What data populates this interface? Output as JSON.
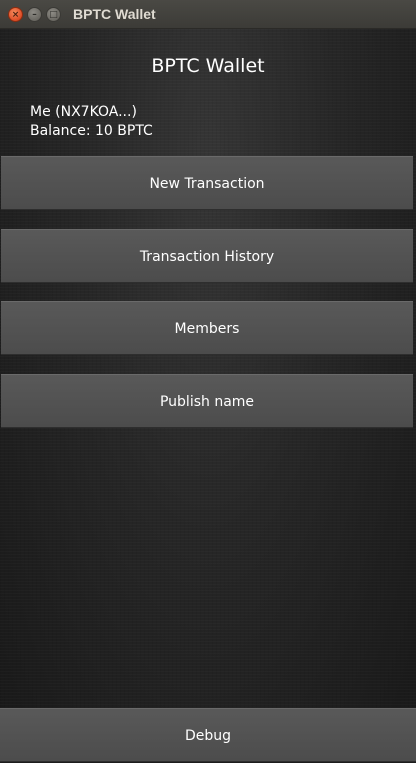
{
  "window": {
    "title": "BPTC Wallet",
    "close_glyph": "×",
    "minimize_glyph": "–",
    "maximize_glyph": "□"
  },
  "app": {
    "title": "BPTC Wallet",
    "account_name": "Me (NX7KOA...)",
    "balance": "Balance: 10 BPTC"
  },
  "buttons": {
    "new_transaction": "New Transaction",
    "transaction_history": "Transaction History",
    "members": "Members",
    "publish_name": "Publish name",
    "debug": "Debug"
  },
  "colors": {
    "button_bg": "#525252",
    "background": "#222222",
    "titlebar": "#3c3b37",
    "close_button": "#e0502a"
  }
}
